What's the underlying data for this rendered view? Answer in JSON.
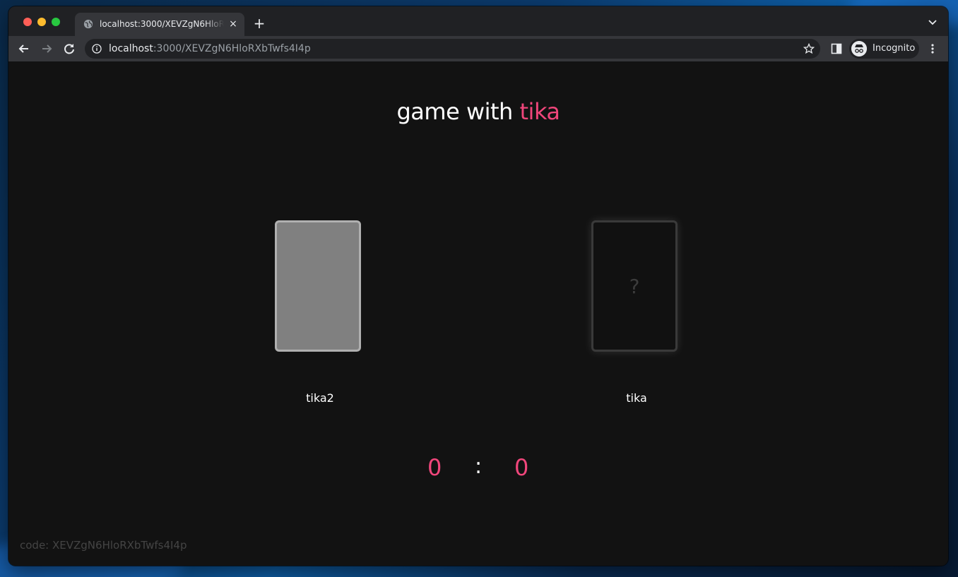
{
  "browser": {
    "tab_title": "localhost:3000/XEVZgN6HloRXbTwfs4I4p",
    "new_tab_label": "+",
    "close_tab_label": "×",
    "url_host": "localhost",
    "url_rest": ":3000/XEVZgN6HloRXbTwfs4I4p",
    "profile_label": "Incognito"
  },
  "game": {
    "title_prefix": "game with ",
    "opponent_name": "tika",
    "player_name": "tika2",
    "opponent_card_symbol": "?",
    "player_score": "0",
    "score_separator": ":",
    "opponent_score": "0",
    "code_label": "code: XEVZgN6HloRXbTwfs4I4p"
  },
  "colors": {
    "accent": "#f0467b",
    "page_background": "#121212",
    "player_card": "#808080"
  },
  "icons": {
    "favicon": "globe-icon",
    "back": "back-arrow-icon",
    "forward": "forward-arrow-icon",
    "reload": "reload-icon",
    "site_info": "info-icon",
    "bookmark": "star-icon",
    "side_panel": "side-panel-icon",
    "incognito": "incognito-icon",
    "menu": "kebab-menu-icon",
    "tab_search": "chevron-down-icon"
  }
}
